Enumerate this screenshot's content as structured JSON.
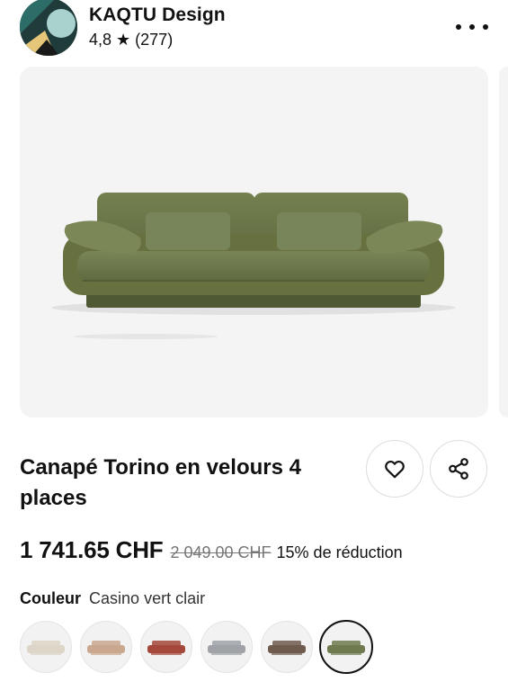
{
  "shop": {
    "name": "KAQTU Design",
    "rating": "4,8 ★ (277)"
  },
  "product": {
    "title": "Canapé Torino en velours 4 places",
    "price": "1 741.65 CHF",
    "old_price": "2 049.00 CHF",
    "discount": "15% de réduction",
    "image_color": "#6f7a4e"
  },
  "color": {
    "label": "Couleur",
    "value": "Casino vert clair",
    "options": [
      {
        "name": "cream",
        "hex": "#ddd5c8",
        "selected": false
      },
      {
        "name": "beige",
        "hex": "#c9a88f",
        "selected": false
      },
      {
        "name": "terracotta",
        "hex": "#a4483b",
        "selected": false
      },
      {
        "name": "grey",
        "hex": "#9fa3a8",
        "selected": false
      },
      {
        "name": "brown",
        "hex": "#6e5b4d",
        "selected": false
      },
      {
        "name": "light-green",
        "hex": "#6f7a4e",
        "selected": true
      }
    ]
  },
  "icons": {
    "more": "more-horizontal-icon",
    "favorite": "heart-icon",
    "share": "share-icon"
  }
}
